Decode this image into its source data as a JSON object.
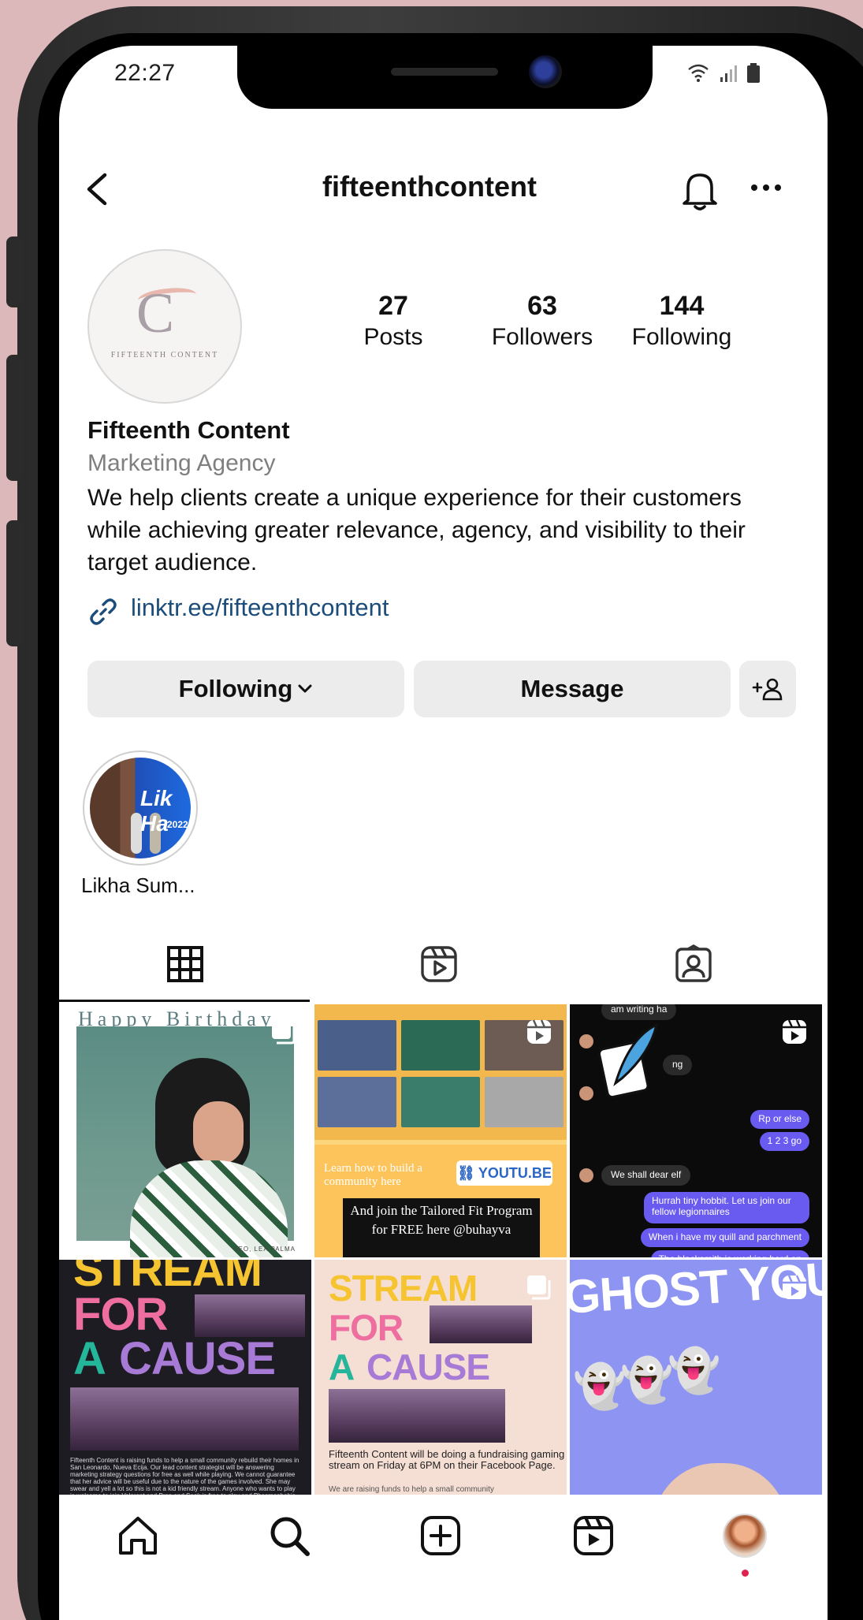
{
  "status_bar": {
    "time": "22:27"
  },
  "header": {
    "username": "fifteenthcontent"
  },
  "profile": {
    "logo_text": "FIFTEENTH CONTENT",
    "stats": [
      {
        "value": "27",
        "label": "Posts"
      },
      {
        "value": "63",
        "label": "Followers"
      },
      {
        "value": "144",
        "label": "Following"
      }
    ],
    "name": "Fifteenth Content",
    "category": "Marketing Agency",
    "bio": "We help clients create a unique experience for their customers while achieving greater relevance, agency, and visibility to their target audience.",
    "link": "linktr.ee/fifteenthcontent"
  },
  "actions": {
    "following_label": "Following",
    "message_label": "Message"
  },
  "highlights": [
    {
      "label": "Likha Sum..."
    }
  ],
  "tabs": [
    {
      "icon": "grid-icon",
      "active": true
    },
    {
      "icon": "reels-icon",
      "active": false
    },
    {
      "icon": "tagged-icon",
      "active": false
    }
  ],
  "posts": {
    "post1": {
      "title": "Happy Birthday",
      "caption": "SEO, LEA PALMA"
    },
    "post2": {
      "learn": "Learn how to build a community here",
      "youtube": "YOUTU.BE",
      "join": "And join the Tailored Fit Program for FREE here @buhayva"
    },
    "post3": {
      "top": "am writing ha",
      "mid": "ng",
      "msgs": [
        "Rp or else",
        "1 2 3 go",
        "We shall dear elf",
        "Hurrah tiny hobbit. Let us join our fellow legionnaires",
        "When i have my quill and parchment",
        "The blacksmith is working hard on"
      ]
    },
    "post4": {
      "line1": "STREAM",
      "line2": "FOR",
      "line3a": "A",
      "line3b": "CAUSE",
      "text": "Fifteenth Content is raising funds to help a small community rebuild their homes in San Leonardo, Nueva Ecija. Our lead content strategist will be answering marketing strategy questions for free as well while playing. We cannot guarantee that her advice will be useful due to the nature of the games involved. She may swear and yell a lot so this is not a kid friendly stream. Anyone who wants to play is welcome to join Valorant and Prop and Seek is free to play and Phasmophobia is available on Steam."
    },
    "post5": {
      "line1": "STREAM",
      "line2": "FOR",
      "line3a": "A",
      "line3b": "CAUSE",
      "text": "Fifteenth Content will be doing a fundraising gaming stream on Friday at 6PM on their Facebook Page.",
      "text2": "We are raising funds to help a small community"
    },
    "post6": {
      "text": "GHOST YOU"
    }
  },
  "colors": {
    "link": "#1c4d7a",
    "stream_yellow": "#f5c430",
    "stream_pink": "#ee6ea0",
    "stream_teal": "#25b59a",
    "stream_purple": "#a77ad6",
    "message_purple": "#6a5bf0",
    "notification_dot": "#e0224f"
  }
}
